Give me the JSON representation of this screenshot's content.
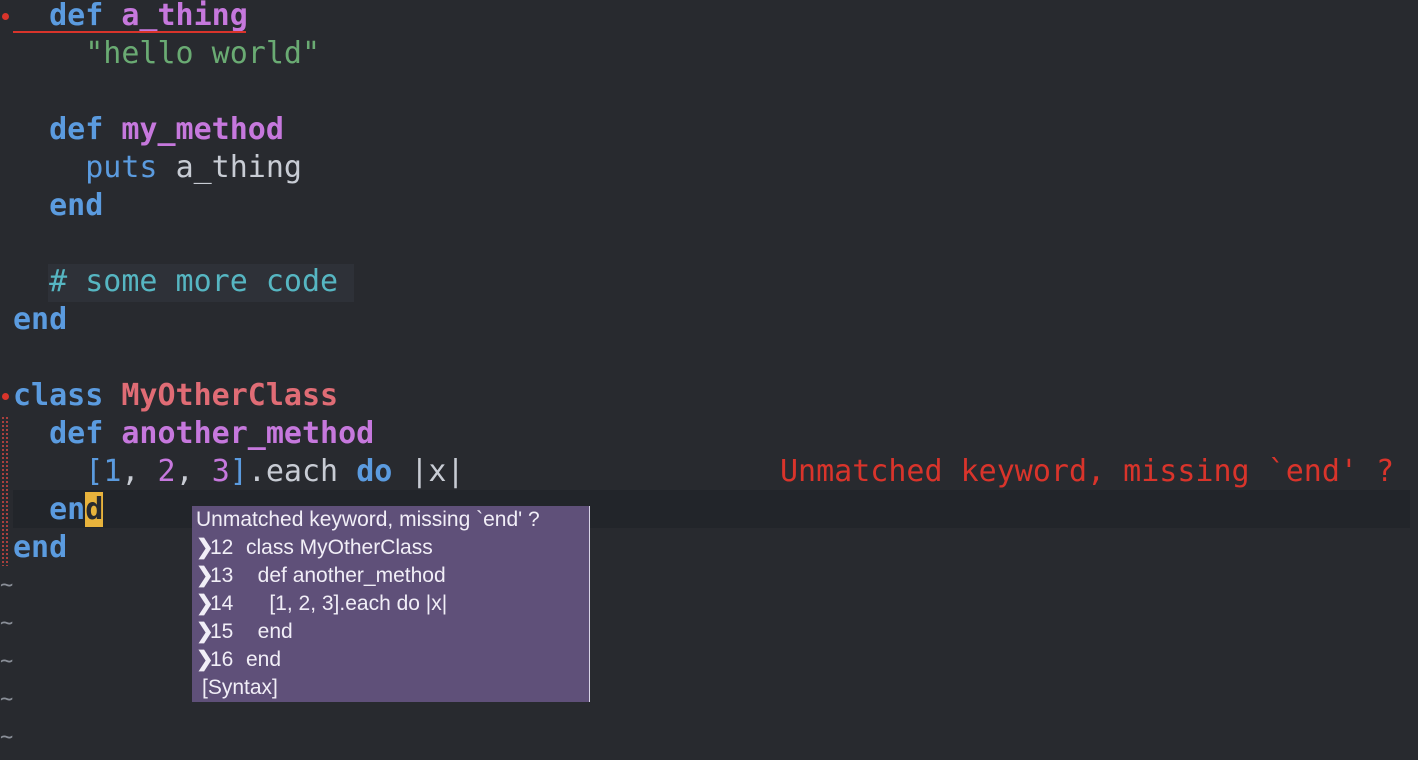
{
  "editor": {
    "lines": {
      "l1": {
        "kw": "def",
        "name": "a_thing"
      },
      "l2": {
        "str": "\"hello world\""
      },
      "l4": {
        "kw": "def",
        "name": "my_method"
      },
      "l5": {
        "builtin": "puts",
        "ident": "a_thing"
      },
      "l6": {
        "kw": "end"
      },
      "l8": {
        "comment": "# some more code"
      },
      "l9": {
        "kw": "end"
      },
      "l11": {
        "kw": "class",
        "name": "MyOtherClass"
      },
      "l12": {
        "kw": "def",
        "name": "another_method"
      },
      "l13": {
        "open": "[",
        "n1": "1",
        "sep1": ", ",
        "n2": "2",
        "sep2": ", ",
        "n3": "3",
        "close": "]",
        "method": ".each",
        "kw": "do",
        "block": "|x|"
      },
      "l14": {
        "kw_before_cursor": "en",
        "cursor_char": "d"
      },
      "l15": {
        "kw": "end"
      }
    },
    "tilde": "~",
    "virtual_text": "Unmatched keyword, missing `end' ?"
  },
  "diagnostic_popup": {
    "message": "Unmatched keyword, missing `end' ?",
    "chevron": "❯",
    "context": [
      {
        "line": "12",
        "code": "class MyOtherClass"
      },
      {
        "line": "13",
        "code": "  def another_method"
      },
      {
        "line": "14",
        "code": "    [1, 2, 3].each do |x|"
      },
      {
        "line": "15",
        "code": "  end"
      },
      {
        "line": "16",
        "code": "end"
      }
    ],
    "source": "[Syntax]"
  },
  "colors": {
    "background": "#282a2f",
    "keyword": "#5b9bdf",
    "function": "#c678dd",
    "class": "#e06c75",
    "string": "#6aab73",
    "comment": "#56b6c2",
    "error": "#d9342b",
    "cursor": "#e8b33c",
    "popup_bg": "#5f5079"
  }
}
